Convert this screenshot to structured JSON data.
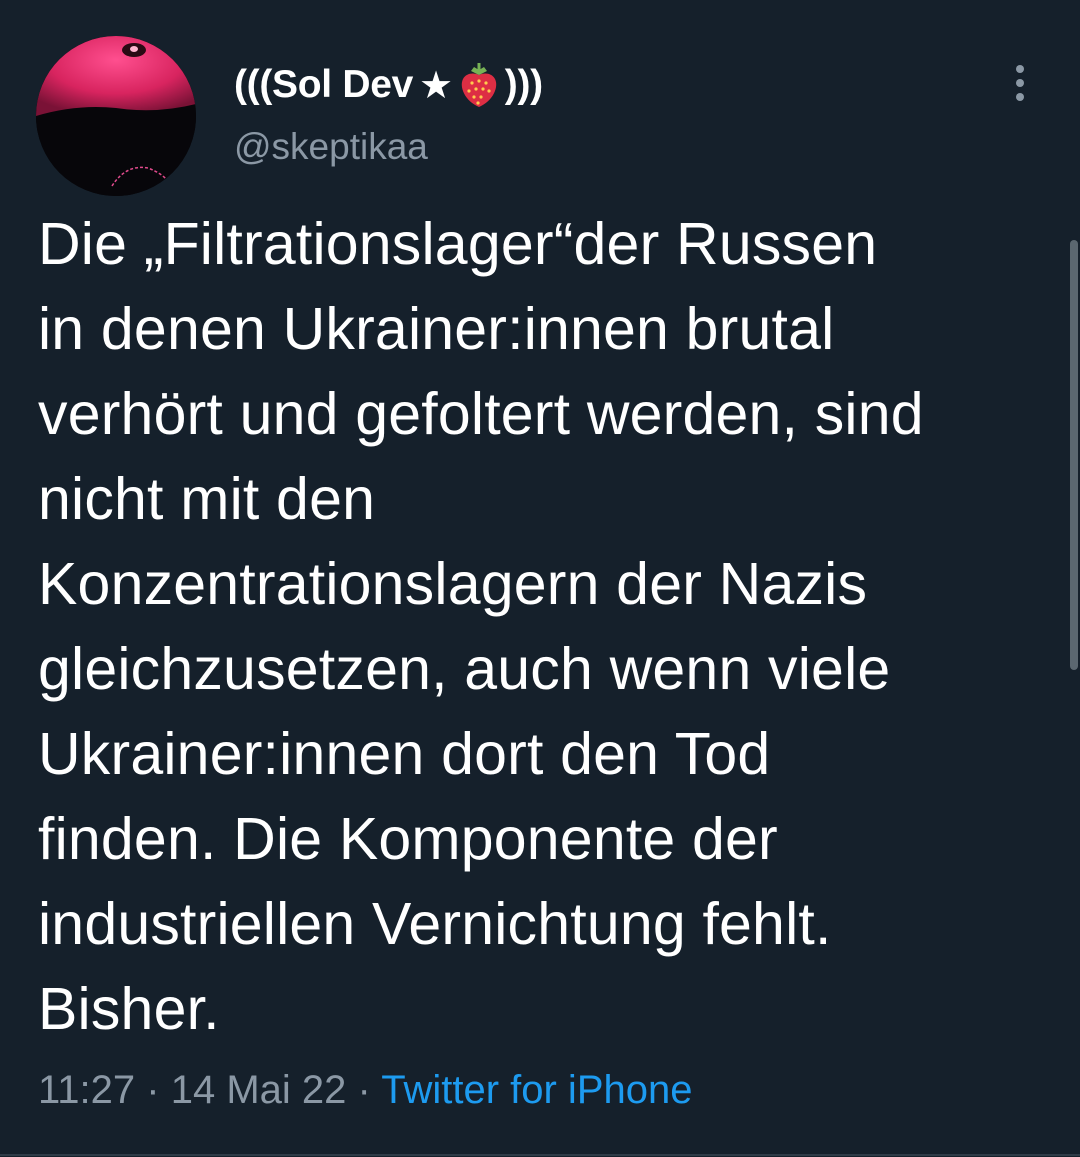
{
  "tweet": {
    "author": {
      "name_prefix": "(((Sol Dev",
      "name_star": "★",
      "name_suffix": ")))",
      "handle": "@skeptikaa",
      "avatar_icon": "profile-photo"
    },
    "text_lines": [
      "Die „Filtrationslager“der Russen",
      "in denen Ukrainer:innen brutal",
      "verhört und gefoltert werden, sind",
      "nicht mit den",
      "Konzentrationslagern der Nazis",
      "gleichzusetzen, auch wenn viele",
      "Ukrainer:innen dort den Tod",
      "finden. Die Komponente der",
      "industriellen Vernichtung fehlt.",
      "Bisher."
    ],
    "time": "11:27",
    "separator": "·",
    "date": "14 Mai 22",
    "source": "Twitter for iPhone"
  },
  "icons": {
    "more": "more-vertical-icon",
    "strawberry": "strawberry-emoji"
  },
  "colors": {
    "background": "#15202b",
    "text_primary": "#ffffff",
    "text_secondary": "#8b98a5",
    "link": "#1d9bf0"
  }
}
